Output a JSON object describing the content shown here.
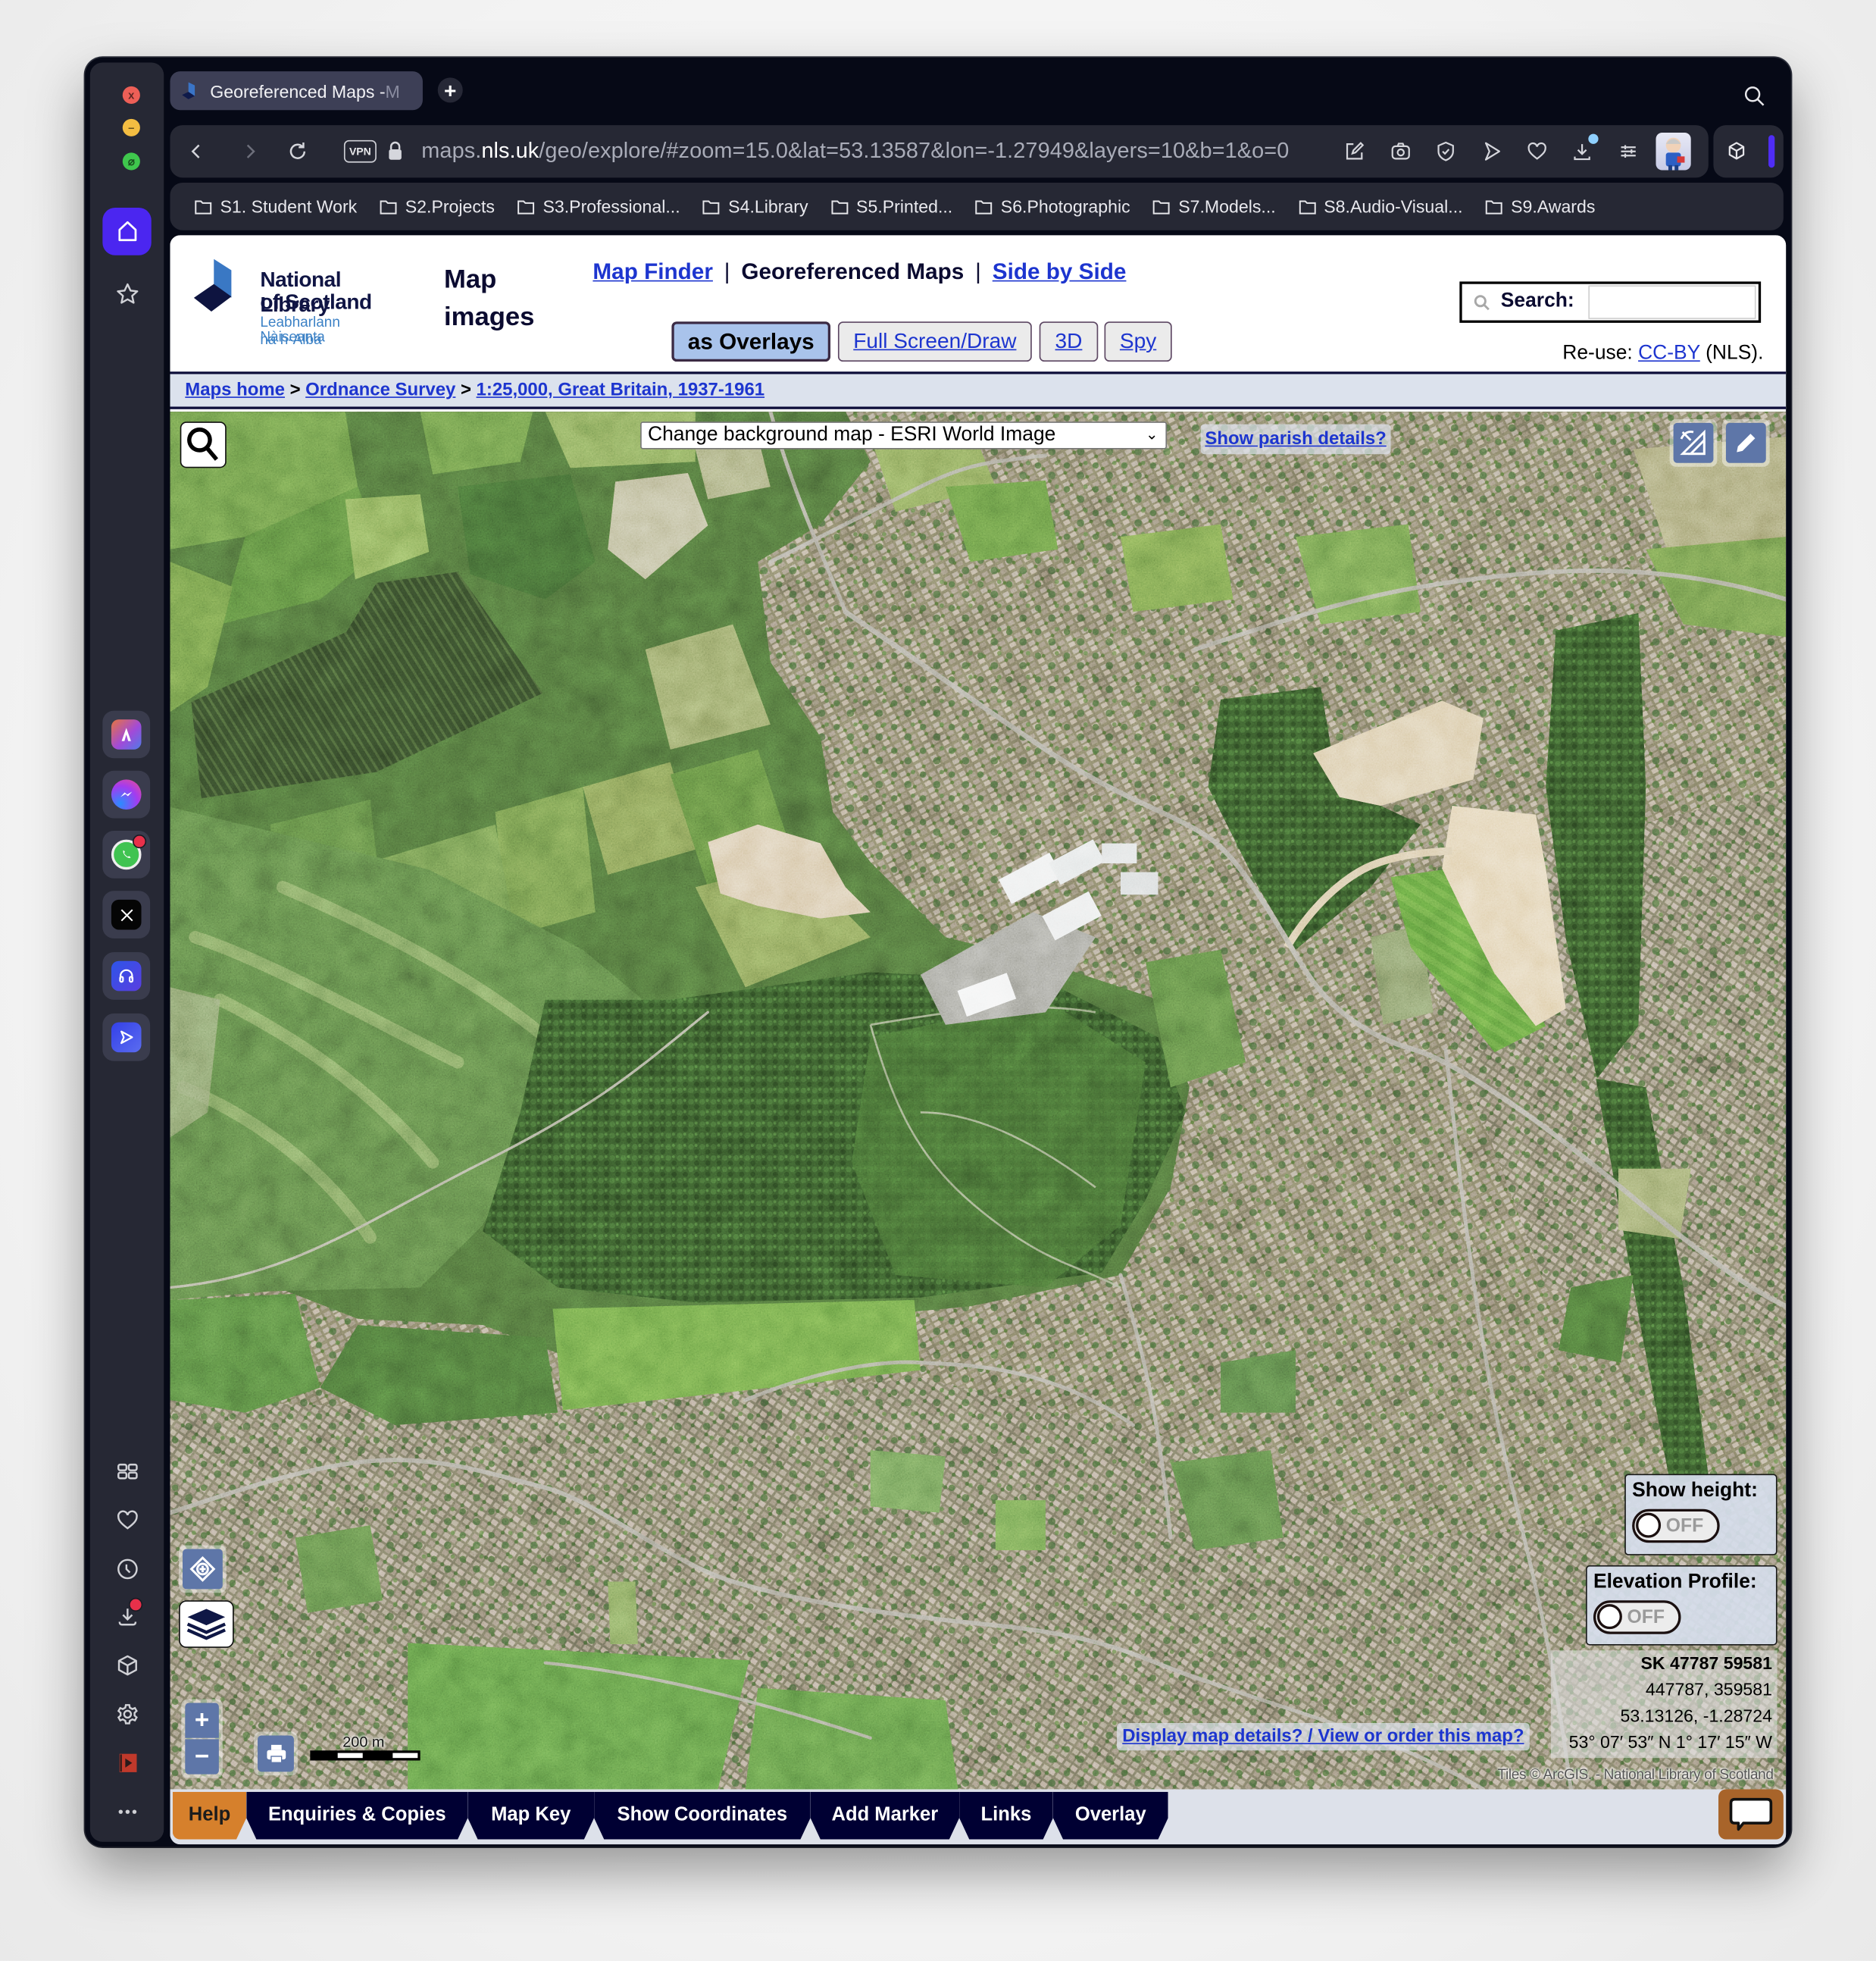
{
  "browser": {
    "tab": {
      "title": "Georeferenced Maps - ",
      "title_faded": "M",
      "favicon": "nls-logo-icon"
    },
    "new_tab_label": "+",
    "address_bar": {
      "vpn_label": "VPN",
      "url_prefix": "maps.",
      "url_domain": "nls.uk",
      "url_rest": "/geo/explore/#zoom=15.0&lat=53.13587&lon=-1.27949&layers=10&b=1&o=0",
      "icons": [
        "back-icon",
        "forward-icon",
        "reload-icon",
        "lock-icon",
        "snapshot-edit-icon",
        "camera-icon",
        "shield-check-icon",
        "send-icon",
        "heart-icon",
        "download-icon",
        "easy-setup-icon",
        "profile-avatar"
      ]
    },
    "bookmarks": [
      "S1. Student Work",
      "S2.Projects",
      "S3.Professional...",
      "S4.Library",
      "S5.Printed...",
      "S6.Photographic",
      "S7.Models...",
      "S8.Audio-Visual...",
      "S9.Awards"
    ],
    "sidebar": {
      "top": [
        "home-icon",
        "star-icon"
      ],
      "apps": [
        "aria-ai-icon",
        "messenger-icon",
        "whatsapp-icon",
        "x-twitter-icon",
        "music-player-icon",
        "my-flow-icon"
      ],
      "bottom": [
        "grid-icon",
        "heart-icon",
        "history-clock-icon",
        "download-icon",
        "cube-icon",
        "settings-gear-icon",
        "video-player-icon",
        "more-dots-icon"
      ]
    }
  },
  "header": {
    "logo": {
      "line1": "National Library",
      "line2": "of Scotland",
      "gaelic1": "Leabharlann Nàiseanta",
      "gaelic2": "na h-Alba"
    },
    "section_title": [
      "Map",
      "images"
    ],
    "nav": {
      "map_finder": "Map Finder",
      "separator": "|",
      "current": "Georeferenced Maps",
      "side_by_side": "Side by Side"
    },
    "view_buttons": [
      {
        "label": "as Overlays",
        "active": true
      },
      {
        "label": "Full Screen/Draw",
        "active": false
      },
      {
        "label": "3D",
        "active": false
      },
      {
        "label": "Spy",
        "active": false
      }
    ],
    "search": {
      "label": "Search:",
      "value": "",
      "placeholder": ""
    },
    "reuse": {
      "prefix": "Re-use: ",
      "license": "CC-BY",
      "suffix": " (NLS)."
    }
  },
  "breadcrumb": {
    "items": [
      "Maps home",
      "Ordnance Survey",
      "1:25,000, Great Britain, 1937-1961"
    ],
    "separator": ">"
  },
  "map": {
    "background_select": {
      "selected": "Change background map - ESRI World Image",
      "chevron": "⌄"
    },
    "parish_link": "Show parish details?",
    "show_height": {
      "label": "Show height:",
      "state": "OFF"
    },
    "elevation_profile": {
      "label": "Elevation Profile:",
      "state": "OFF"
    },
    "coordinates": {
      "os_grid_ref": "SK 47787 59581",
      "easting_northing": "447787, 359581",
      "lat_lon": "53.13126, -1.28724",
      "dms": "53° 07′ 53″ N 1° 17′ 15″ W"
    },
    "details_link": "Display map details? / View or order this map?",
    "zoom_in": "+",
    "zoom_out": "−",
    "scale_label": "200 m",
    "attribution": "Tiles © ArcGIS. - National Library of Scotland",
    "view": {
      "zoom": 15.0,
      "lat": 53.13587,
      "lon": -1.27949
    }
  },
  "bottom_tabs": [
    {
      "label": "Help",
      "active": true
    },
    {
      "label": "Enquiries & Copies"
    },
    {
      "label": "Map Key"
    },
    {
      "label": "Show Coordinates"
    },
    {
      "label": "Add Marker"
    },
    {
      "label": "Links"
    },
    {
      "label": "Overlay"
    }
  ],
  "colors": {
    "link_blue": "#1d35cf",
    "nls_navy": "#000033",
    "help_orange": "#d6802c",
    "active_button": "#a9c3eb",
    "browser_accent": "#4b26f0",
    "chat_button": "#a8642a"
  }
}
